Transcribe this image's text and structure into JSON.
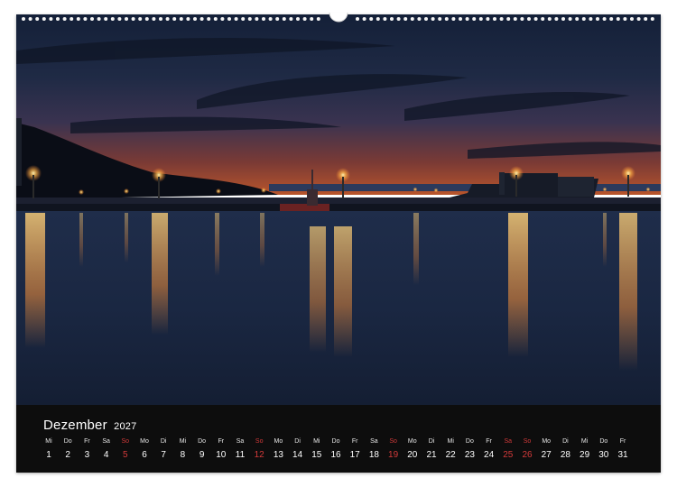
{
  "calendar": {
    "month": "Dezember",
    "year": "2027",
    "days": [
      {
        "wd": "Mi",
        "d": "1",
        "we": false
      },
      {
        "wd": "Do",
        "d": "2",
        "we": false
      },
      {
        "wd": "Fr",
        "d": "3",
        "we": false
      },
      {
        "wd": "Sa",
        "d": "4",
        "we": false
      },
      {
        "wd": "So",
        "d": "5",
        "we": true
      },
      {
        "wd": "Mo",
        "d": "6",
        "we": false
      },
      {
        "wd": "Di",
        "d": "7",
        "we": false
      },
      {
        "wd": "Mi",
        "d": "8",
        "we": false
      },
      {
        "wd": "Do",
        "d": "9",
        "we": false
      },
      {
        "wd": "Fr",
        "d": "10",
        "we": false
      },
      {
        "wd": "Sa",
        "d": "11",
        "we": false
      },
      {
        "wd": "So",
        "d": "12",
        "we": true
      },
      {
        "wd": "Mo",
        "d": "13",
        "we": false
      },
      {
        "wd": "Di",
        "d": "14",
        "we": false
      },
      {
        "wd": "Mi",
        "d": "15",
        "we": false
      },
      {
        "wd": "Do",
        "d": "16",
        "we": false
      },
      {
        "wd": "Fr",
        "d": "17",
        "we": false
      },
      {
        "wd": "Sa",
        "d": "18",
        "we": false
      },
      {
        "wd": "So",
        "d": "19",
        "we": true
      },
      {
        "wd": "Mo",
        "d": "20",
        "we": false
      },
      {
        "wd": "Di",
        "d": "21",
        "we": false
      },
      {
        "wd": "Mi",
        "d": "22",
        "we": false
      },
      {
        "wd": "Do",
        "d": "23",
        "we": false
      },
      {
        "wd": "Fr",
        "d": "24",
        "we": false
      },
      {
        "wd": "Sa",
        "d": "25",
        "we": true
      },
      {
        "wd": "So",
        "d": "26",
        "we": true
      },
      {
        "wd": "Mo",
        "d": "27",
        "we": false
      },
      {
        "wd": "Di",
        "d": "28",
        "we": false
      },
      {
        "wd": "Mi",
        "d": "29",
        "we": false
      },
      {
        "wd": "Do",
        "d": "30",
        "we": false
      },
      {
        "wd": "Fr",
        "d": "31",
        "we": false
      }
    ]
  },
  "colors": {
    "weekend": "#d23a3a",
    "calendar_bg": "#0d0d0d"
  }
}
